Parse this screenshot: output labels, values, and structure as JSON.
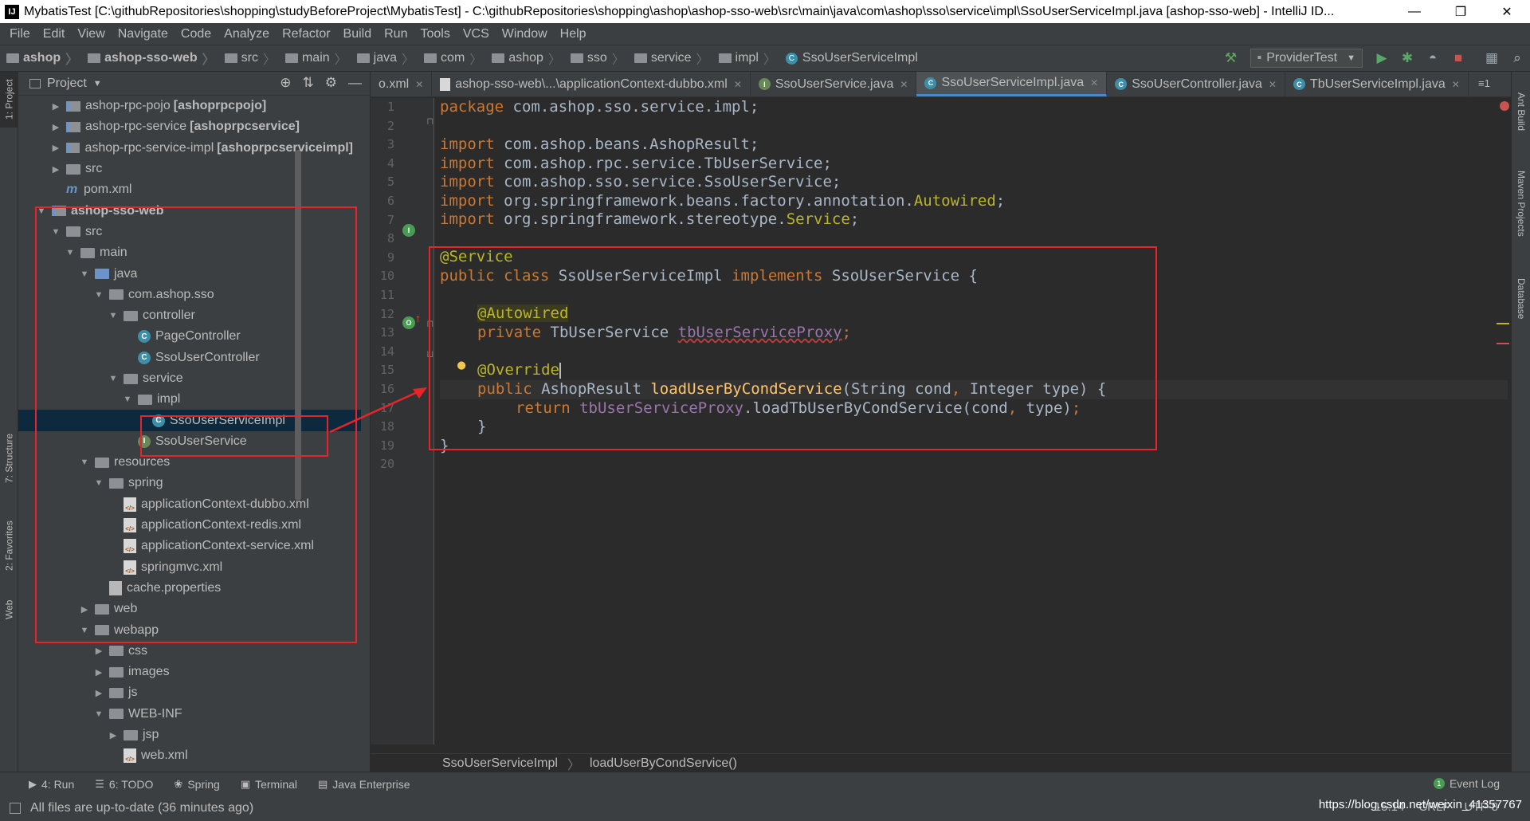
{
  "window": {
    "title": "MybatisTest [C:\\githubRepositories\\shopping\\studyBeforeProject\\MybatisTest] - C:\\githubRepositories\\shopping\\ashop\\ashop-sso-web\\src\\main\\java\\com\\ashop\\sso\\service\\impl\\SsoUserServiceImpl.java [ashop-sso-web] - IntelliJ ID...",
    "app_icon": "IJ",
    "minimize": "—",
    "restore": "❐",
    "close": "✕"
  },
  "menu": [
    "File",
    "Edit",
    "View",
    "Navigate",
    "Code",
    "Analyze",
    "Refactor",
    "Build",
    "Run",
    "Tools",
    "VCS",
    "Window",
    "Help"
  ],
  "breadcrumbs": [
    "ashop",
    "ashop-sso-web",
    "src",
    "main",
    "java",
    "com",
    "ashop",
    "sso",
    "service",
    "impl",
    "SsoUserServiceImpl"
  ],
  "run_config": "ProviderTest",
  "project_panel": {
    "title": "Project"
  },
  "tree": [
    {
      "indent": 2,
      "arrow": "▶",
      "icon": "module",
      "label": "ashop-rpc-pojo",
      "suffix": "[ashoprpcpojo]"
    },
    {
      "indent": 2,
      "arrow": "▶",
      "icon": "module",
      "label": "ashop-rpc-service",
      "suffix": "[ashoprpcservice]"
    },
    {
      "indent": 2,
      "arrow": "▶",
      "icon": "module",
      "label": "ashop-rpc-service-impl",
      "suffix": "[ashoprpcserviceimpl]"
    },
    {
      "indent": 2,
      "arrow": "▶",
      "icon": "folder",
      "label": "src",
      "suffix": ""
    },
    {
      "indent": 2,
      "arrow": "",
      "icon": "maven",
      "label": "pom.xml",
      "suffix": ""
    },
    {
      "indent": 1,
      "arrow": "▼",
      "icon": "module",
      "label": "ashop-sso-web",
      "suffix": "",
      "bold": true
    },
    {
      "indent": 2,
      "arrow": "▼",
      "icon": "folder",
      "label": "src",
      "suffix": ""
    },
    {
      "indent": 3,
      "arrow": "▼",
      "icon": "folder",
      "label": "main",
      "suffix": ""
    },
    {
      "indent": 4,
      "arrow": "▼",
      "icon": "folder-blue",
      "label": "java",
      "suffix": ""
    },
    {
      "indent": 5,
      "arrow": "▼",
      "icon": "folder",
      "label": "com.ashop.sso",
      "suffix": ""
    },
    {
      "indent": 6,
      "arrow": "▼",
      "icon": "folder",
      "label": "controller",
      "suffix": ""
    },
    {
      "indent": 7,
      "arrow": "",
      "icon": "class",
      "label": "PageController",
      "suffix": ""
    },
    {
      "indent": 7,
      "arrow": "",
      "icon": "class",
      "label": "SsoUserController",
      "suffix": ""
    },
    {
      "indent": 6,
      "arrow": "▼",
      "icon": "folder",
      "label": "service",
      "suffix": ""
    },
    {
      "indent": 7,
      "arrow": "▼",
      "icon": "folder",
      "label": "impl",
      "suffix": ""
    },
    {
      "indent": 8,
      "arrow": "",
      "icon": "class",
      "label": "SsoUserServiceImpl",
      "suffix": "",
      "selected": true
    },
    {
      "indent": 7,
      "arrow": "",
      "icon": "interface",
      "label": "SsoUserService",
      "suffix": ""
    },
    {
      "indent": 4,
      "arrow": "▼",
      "icon": "folder-res",
      "label": "resources",
      "suffix": ""
    },
    {
      "indent": 5,
      "arrow": "▼",
      "icon": "folder",
      "label": "spring",
      "suffix": ""
    },
    {
      "indent": 6,
      "arrow": "",
      "icon": "xml",
      "label": "applicationContext-dubbo.xml",
      "suffix": ""
    },
    {
      "indent": 6,
      "arrow": "",
      "icon": "xml",
      "label": "applicationContext-redis.xml",
      "suffix": ""
    },
    {
      "indent": 6,
      "arrow": "",
      "icon": "xml",
      "label": "applicationContext-service.xml",
      "suffix": ""
    },
    {
      "indent": 6,
      "arrow": "",
      "icon": "xml",
      "label": "springmvc.xml",
      "suffix": ""
    },
    {
      "indent": 5,
      "arrow": "",
      "icon": "props",
      "label": "cache.properties",
      "suffix": ""
    },
    {
      "indent": 4,
      "arrow": "▶",
      "icon": "folder",
      "label": "web",
      "suffix": ""
    },
    {
      "indent": 4,
      "arrow": "▼",
      "icon": "folder",
      "label": "webapp",
      "suffix": ""
    },
    {
      "indent": 5,
      "arrow": "▶",
      "icon": "folder",
      "label": "css",
      "suffix": ""
    },
    {
      "indent": 5,
      "arrow": "▶",
      "icon": "folder",
      "label": "images",
      "suffix": ""
    },
    {
      "indent": 5,
      "arrow": "▶",
      "icon": "folder",
      "label": "js",
      "suffix": ""
    },
    {
      "indent": 5,
      "arrow": "▼",
      "icon": "folder",
      "label": "WEB-INF",
      "suffix": ""
    },
    {
      "indent": 6,
      "arrow": "▶",
      "icon": "folder",
      "label": "jsp",
      "suffix": ""
    },
    {
      "indent": 6,
      "arrow": "",
      "icon": "xml",
      "label": "web.xml",
      "suffix": ""
    }
  ],
  "editor_tabs": [
    {
      "label": "o.xml",
      "icon": "none",
      "active": false
    },
    {
      "label": "ashop-sso-web\\...\\applicationContext-dubbo.xml",
      "icon": "xml",
      "active": false
    },
    {
      "label": "SsoUserService.java",
      "icon": "interface",
      "active": false
    },
    {
      "label": "SsoUserServiceImpl.java",
      "icon": "class",
      "active": true
    },
    {
      "label": "SsoUserController.java",
      "icon": "class",
      "active": false
    },
    {
      "label": "TbUserServiceImpl.java",
      "icon": "class",
      "active": false
    }
  ],
  "tab_overflow": "≡1",
  "line_numbers": [
    "1",
    "2",
    "3",
    "4",
    "5",
    "6",
    "7",
    "8",
    "9",
    "10",
    "11",
    "12",
    "13",
    "14",
    "15",
    "16",
    "17",
    "18",
    "19",
    "20"
  ],
  "code": {
    "l1_kw": "package",
    "l1_rest": " com.ashop.sso.service.impl;",
    "imports": [
      {
        "path": " com.ashop.beans.AshopResult;",
        "ann": ""
      },
      {
        "path": " com.ashop.rpc.service.TbUserService;",
        "ann": ""
      },
      {
        "path": " com.ashop.sso.service.SsoUserService;",
        "ann": ""
      },
      {
        "path": " org.springframework.beans.factory.annotation.",
        "ann": "Autowired"
      },
      {
        "path": " org.springframework.stereotype.",
        "ann": "Service"
      }
    ],
    "import_kw": "import",
    "semicolon": ";",
    "l9": "@Service",
    "l10_kw1": "public class",
    "l10_name": " SsoUserServiceImpl ",
    "l10_kw2": "implements",
    "l10_rest": " SsoUserService {",
    "l12": "@Autowired",
    "l13_kw": "private",
    "l13_type": " TbUserService ",
    "l13_field": "tbUserServiceProxy",
    "l15": "@Override",
    "l16_kw": "public",
    "l16_type": " AshopResult ",
    "l16_method": "loadUserByCondService",
    "l16_p1": "(String cond",
    "l16_p2": " Integer type) {",
    "comma": ",",
    "l17_kw": "return",
    "l17_field": "tbUserServiceProxy",
    "l17_call": ".loadTbUserByCondService(cond",
    "l17_end": " type)",
    "l18": "}",
    "l19": "}"
  },
  "editor_footer": {
    "class": "SsoUserServiceImpl",
    "method": "loadUserByCondService()"
  },
  "bottom_tools": [
    {
      "icon": "▶",
      "label": "4: Run"
    },
    {
      "icon": "☰",
      "label": "6: TODO"
    },
    {
      "icon": "❀",
      "label": "Spring"
    },
    {
      "icon": "▣",
      "label": "Terminal"
    },
    {
      "icon": "▤",
      "label": "Java Enterprise"
    }
  ],
  "event_log": "Event Log",
  "status": {
    "message": "All files are up-to-date (36 minutes ago)",
    "position": "15:14",
    "line_sep": "CRLF",
    "encoding": "UTF-8"
  },
  "watermark": "https://blog.csdn.net/weixin_41357767",
  "left_tabs": [
    "1: Project",
    "7: Structure",
    "2: Favorites",
    "Web"
  ],
  "right_tabs": [
    "Ant Build",
    "Maven Projects",
    "Database"
  ],
  "colors": {
    "bg": "#2b2b2b",
    "panel": "#3c3f41",
    "keyword": "#cc7832",
    "annotation": "#bbb529",
    "field": "#9876aa",
    "method": "#ffc66d",
    "annotation_box": "#e8242a"
  }
}
